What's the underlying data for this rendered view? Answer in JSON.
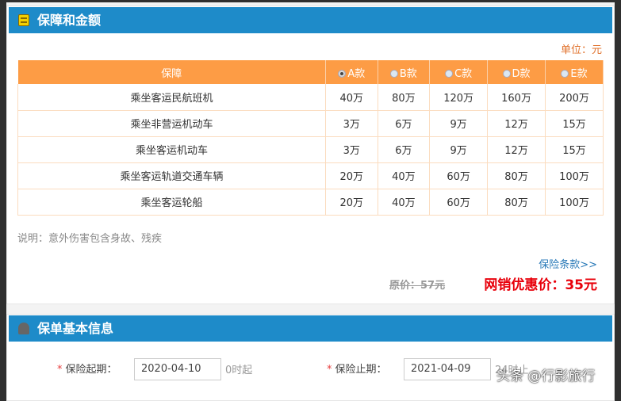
{
  "section1": {
    "title": "保障和金额",
    "unit": "单位：元"
  },
  "table": {
    "headers": [
      "保障",
      "A款",
      "B款",
      "C款",
      "D款",
      "E款"
    ],
    "selected": 0,
    "rows": [
      [
        "乘坐客运民航班机",
        "40万",
        "80万",
        "120万",
        "160万",
        "200万"
      ],
      [
        "乘坐非营运机动车",
        "3万",
        "6万",
        "9万",
        "12万",
        "15万"
      ],
      [
        "乘坐客运机动车",
        "3万",
        "6万",
        "9万",
        "12万",
        "15万"
      ],
      [
        "乘坐客运轨道交通车辆",
        "20万",
        "40万",
        "60万",
        "80万",
        "100万"
      ],
      [
        "乘坐客运轮船",
        "20万",
        "40万",
        "60万",
        "80万",
        "100万"
      ]
    ]
  },
  "note": "说明：意外伤害包含身故、残疾",
  "terms_link": "保险条款>>",
  "original_price": "原价：57元",
  "sale_price": "网销优惠价：35元",
  "section2": {
    "title": "保单基本信息"
  },
  "form": {
    "required_mark": "*",
    "start_label": "保险起期：",
    "start_value": "2020-04-10",
    "start_suffix": "0时起",
    "end_label": "保险止期：",
    "end_value": "2021-04-09",
    "end_suffix": "24时止"
  },
  "watermark": "头条 @行影旅行"
}
